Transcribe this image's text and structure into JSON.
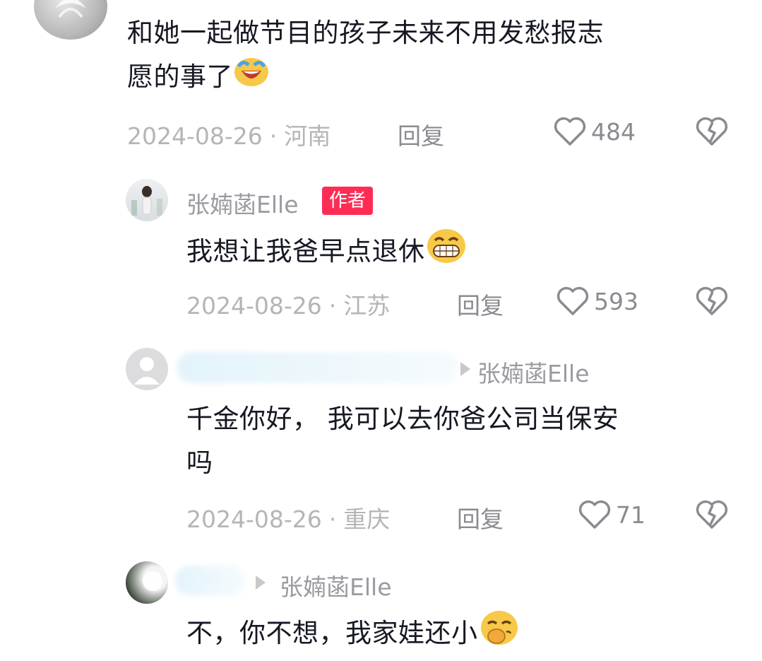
{
  "comments": [
    {
      "text_line1": "和她一起做节目的孩子未来不用发愁报志",
      "text_line2": "愿的事了",
      "emoji": "laughing-crying-emoji",
      "date": "2024-08-26",
      "location": "河南",
      "reply_label": "回复",
      "likes": "484"
    },
    {
      "username": "张婻菡Elle",
      "badge": "作者",
      "text_line1": "我想让我爸早点退休",
      "emoji": "grinning-emoji",
      "date": "2024-08-26",
      "location": "江苏",
      "reply_label": "回复",
      "likes": "593"
    },
    {
      "reply_to": "张婻菡Elle",
      "text_line1": "千金你好， 我可以去你爸公司当保安",
      "text_line2": "吗",
      "date": "2024-08-26",
      "location": "重庆",
      "reply_label": "回复",
      "likes": "71"
    },
    {
      "reply_to": "张婻菡Elle",
      "text_line1": "不，你不想，我家娃还小",
      "emoji": "shushing-emoji"
    }
  ],
  "colors": {
    "text": "#161823",
    "meta": "#b5b5b8",
    "badge": "#fe2c55"
  }
}
